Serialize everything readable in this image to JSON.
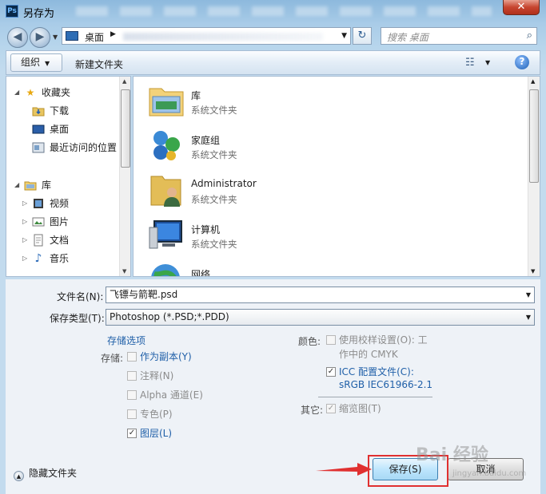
{
  "window": {
    "title": "另存为",
    "app_icon": "photoshop-icon",
    "close_glyph": "✕"
  },
  "nav": {
    "back_glyph": "◀",
    "forward_glyph": "▶",
    "address": "桌面",
    "address_sep": "▶",
    "refresh_glyph": "↻",
    "search_placeholder": "搜索 桌面",
    "search_glyph": "⌕"
  },
  "toolbar": {
    "organize": "组织",
    "new_folder": "新建文件夹",
    "help_glyph": "?",
    "view_glyph": "☷"
  },
  "sidebar": {
    "items": [
      {
        "label": "收藏夹",
        "icon": "star-icon"
      },
      {
        "label": "下载",
        "icon": "download-folder-icon"
      },
      {
        "label": "桌面",
        "icon": "desktop-icon"
      },
      {
        "label": "最近访问的位置",
        "icon": "recent-places-icon"
      },
      {
        "label": "库",
        "icon": "library-icon"
      },
      {
        "label": "视频",
        "icon": "video-library-icon"
      },
      {
        "label": "图片",
        "icon": "picture-library-icon"
      },
      {
        "label": "文档",
        "icon": "document-library-icon"
      },
      {
        "label": "音乐",
        "icon": "music-library-icon"
      }
    ]
  },
  "files": [
    {
      "name": "库",
      "type": "系统文件夹",
      "icon": "library-folder-icon"
    },
    {
      "name": "家庭组",
      "type": "系统文件夹",
      "icon": "homegroup-icon"
    },
    {
      "name": "Administrator",
      "type": "系统文件夹",
      "icon": "user-folder-icon"
    },
    {
      "name": "计算机",
      "type": "系统文件夹",
      "icon": "computer-icon"
    },
    {
      "name": "网络",
      "type": "",
      "icon": "network-icon"
    }
  ],
  "form": {
    "filename_label": "文件名(N):",
    "filename_value": "飞镖与箭靶.psd",
    "filetype_label": "保存类型(T):",
    "filetype_value": "Photoshop (*.PSD;*.PDD)"
  },
  "options": {
    "section_title": "存储选项",
    "storage_label": "存储:",
    "as_copy": {
      "label": "作为副本(Y)",
      "checked": false,
      "enabled": true
    },
    "annotations": {
      "label": "注释(N)",
      "checked": false,
      "enabled": false
    },
    "alpha": {
      "label": "Alpha 通道(E)",
      "checked": false,
      "enabled": false
    },
    "spot": {
      "label": "专色(P)",
      "checked": false,
      "enabled": false
    },
    "layers": {
      "label": "图层(L)",
      "checked": true,
      "enabled": true
    },
    "color_label": "颜色:",
    "proof": {
      "label_line1": "使用校样设置(O): 工",
      "label_line2": "作中的 CMYK",
      "checked": false,
      "enabled": false
    },
    "icc": {
      "label_line1": "ICC 配置文件(C):",
      "label_line2": "sRGB IEC61966-2.1",
      "checked": true,
      "enabled": true
    },
    "other_label": "其它:",
    "thumbnail": {
      "label": "缩览图(T)",
      "checked": true,
      "enabled": false
    }
  },
  "footer": {
    "hide_folders": "隐藏文件夹",
    "save": "保存(S)",
    "cancel": "取消"
  },
  "watermark": {
    "text": "Bai 经验",
    "sub": "jingyan.baidu.com"
  },
  "colors": {
    "accent_link": "#1f5fa8",
    "highlight": "#e03030",
    "title_bg": "#8db9dd"
  }
}
